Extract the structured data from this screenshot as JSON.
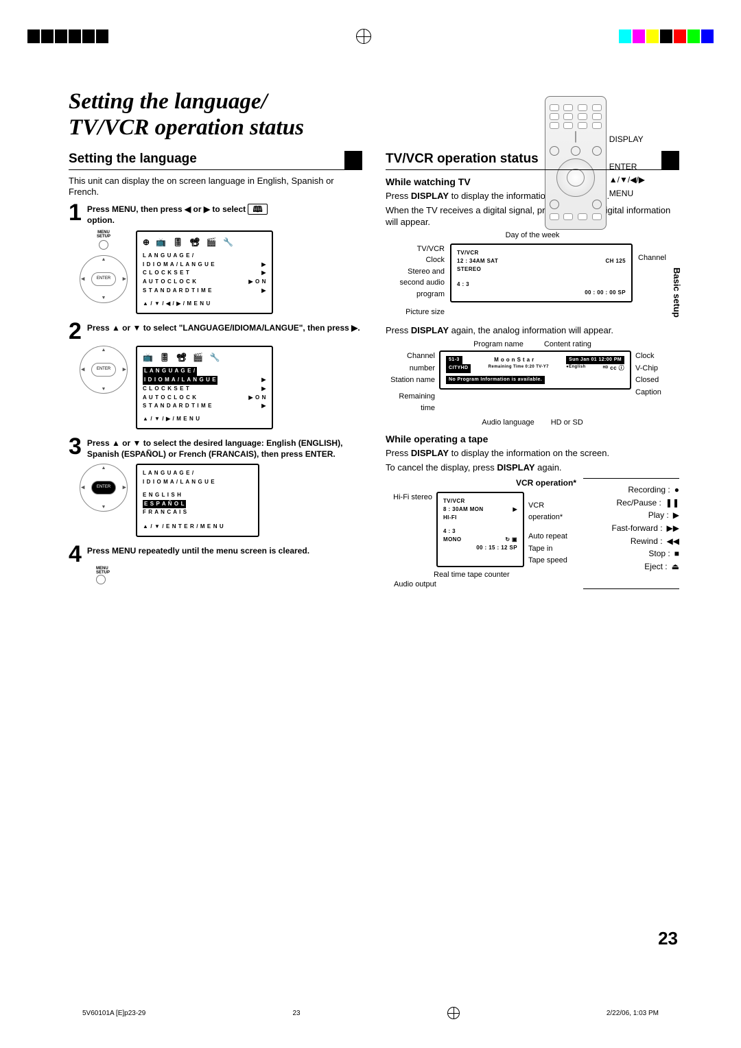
{
  "page_title_line1": "Setting the language/",
  "page_title_line2": "TV/VCR operation status",
  "remote_labels": {
    "display": "DISPLAY",
    "enter": "ENTER",
    "arrows": "▲/▼/◀/▶",
    "menu": "MENU"
  },
  "left": {
    "heading": "Setting the language",
    "intro": "This unit can display the on screen language in English, Spanish or French.",
    "steps": {
      "s1": {
        "num": "1",
        "text_a": "Press MENU, then press ◀ or ▶ to select ",
        "text_b": "option."
      },
      "s2": {
        "num": "2",
        "text_a": "Press ▲ or ▼ to select \"LANGUAGE/IDIOMA/LANGUE\", then press ▶."
      },
      "s3": {
        "num": "3",
        "text_a": "Press ▲ or ▼ to select the desired language: English (ENGLISH), Spanish (ESPAÑOL) or French (FRANCAIS), then press ENTER."
      },
      "s4": {
        "num": "4",
        "text_a": "Press MENU repeatedly until the menu screen is cleared."
      }
    },
    "osd1": {
      "icon_row": "⊕ 📺 🎚 📽 🎬 🔧",
      "r1": "L A N G U A G E  /",
      "r2a": "I D I O M A  /  L A N G U E",
      "r2b": "▶",
      "r3a": "C L O C K  S E T",
      "r3b": "▶",
      "r4a": "A U T O  C L O C K",
      "r4b": "▶  O N",
      "r5a": "S T A N D A R D  T I M E",
      "r5b": "▶",
      "foot": "▲ / ▼ / ◀ / ▶ / M E N U"
    },
    "osd2": {
      "icon_row": "📺 🎚 📽 🎬 🔧",
      "r1": "L A N G U A G E  /",
      "r2a": "I D I O M A  /  L A N G U E",
      "r2b": "▶",
      "r3a": "C L O C K  S E T",
      "r3b": "▶",
      "r4a": "A U T O  C L O C K",
      "r4b": "▶  O N",
      "r5a": "S T A N D A R D  T I M E",
      "r5b": "▶",
      "foot": "▲ / ▼ / ▶ / M E N U"
    },
    "osd3": {
      "r1": "L A N G U A G E  /",
      "r2": "I D I O M A  /  L A N G U E",
      "r3": "E N G L I S H",
      "r4": "E S P A Ñ O L",
      "r5": "F R A N C A I S",
      "foot": "▲ / ▼ / E N T E R  /  M E N U"
    },
    "menu_setup": "MENU\nSETUP",
    "enter_label": "ENTER"
  },
  "right": {
    "heading": "TV/VCR operation status",
    "watch_head": "While watching TV",
    "watch_p1_a": "Press ",
    "watch_p1_b": "DISPLAY",
    "watch_p1_c": " to display the information on the screen.",
    "watch_p2": "When the TV receives a digital signal, press once, the digital information will appear.",
    "labels1": {
      "tvvcr": "TV/VCR",
      "clock": "Clock",
      "stereo": "Stereo and second audio program",
      "picsize": "Picture size",
      "dow": "Day of the week",
      "channel": "Channel"
    },
    "box1": {
      "tvvcr": "TV/VCR",
      "clock": "12 : 34AM SAT",
      "ch": "CH 125",
      "stereo": "STEREO",
      "asp": "4 : 3",
      "tape": "00 : 00 : 00  SP"
    },
    "again_a": "Press ",
    "again_b": "DISPLAY",
    "again_c": " again, the analog information will appear.",
    "labels2": {
      "progname": "Program name",
      "rating": "Content rating",
      "chnum": "Channel number",
      "station": "Station name",
      "remain": "Remaining time",
      "audio": "Audio language",
      "hdsd": "HD or SD",
      "clock": "Clock",
      "vchip": "V-Chip",
      "cc": "Closed Caption"
    },
    "box2": {
      "ch": "51-3",
      "prog": "M o o n  S t a r",
      "date": "Sun Jan 01  12:00 PM",
      "station": "CITYHD",
      "remain": "Remaining Time  0:20  TV-Y7",
      "lang": "●English",
      "noprog": "No Program Information is available."
    },
    "tape_head": "While operating a tape",
    "tape_p1_a": "Press ",
    "tape_p1_b": "DISPLAY",
    "tape_p1_c": " to display the information on the screen.",
    "tape_p2_a": "To cancel the display, press ",
    "tape_p2_b": "DISPLAY",
    "tape_p2_c": " again.",
    "vcr_title": "VCR operation*",
    "labels3": {
      "hifi": "Hi-Fi stereo",
      "vcr": "VCR operation*",
      "autorep": "Auto repeat",
      "tapein": "Tape in",
      "tapespeed": "Tape speed",
      "counter": "Real time tape counter",
      "audioout": "Audio output"
    },
    "box3": {
      "tvvcr": "TV/VCR",
      "clock": "8 : 30AM MON",
      "hifi": "HI-FI",
      "asp": "4 : 3",
      "mono": "MONO",
      "tape": "00 : 15 : 12  SP",
      "sym": "↻ ▣"
    },
    "ops": {
      "rec": "Recording :",
      "rec_s": "●",
      "pause": "Rec/Pause :",
      "pause_s": "❚❚",
      "play": "Play :",
      "play_s": "▶",
      "ff": "Fast-forward :",
      "ff_s": "▶▶",
      "rw": "Rewind :",
      "rw_s": "◀◀",
      "stop": "Stop :",
      "stop_s": "■",
      "eject": "Eject :",
      "eject_s": "⏏"
    }
  },
  "side_tab": "Basic setup",
  "page_number": "23",
  "footer_left": "5V60101A [E]p23-29",
  "footer_mid": "23",
  "footer_right": "2/22/06, 1:03 PM"
}
